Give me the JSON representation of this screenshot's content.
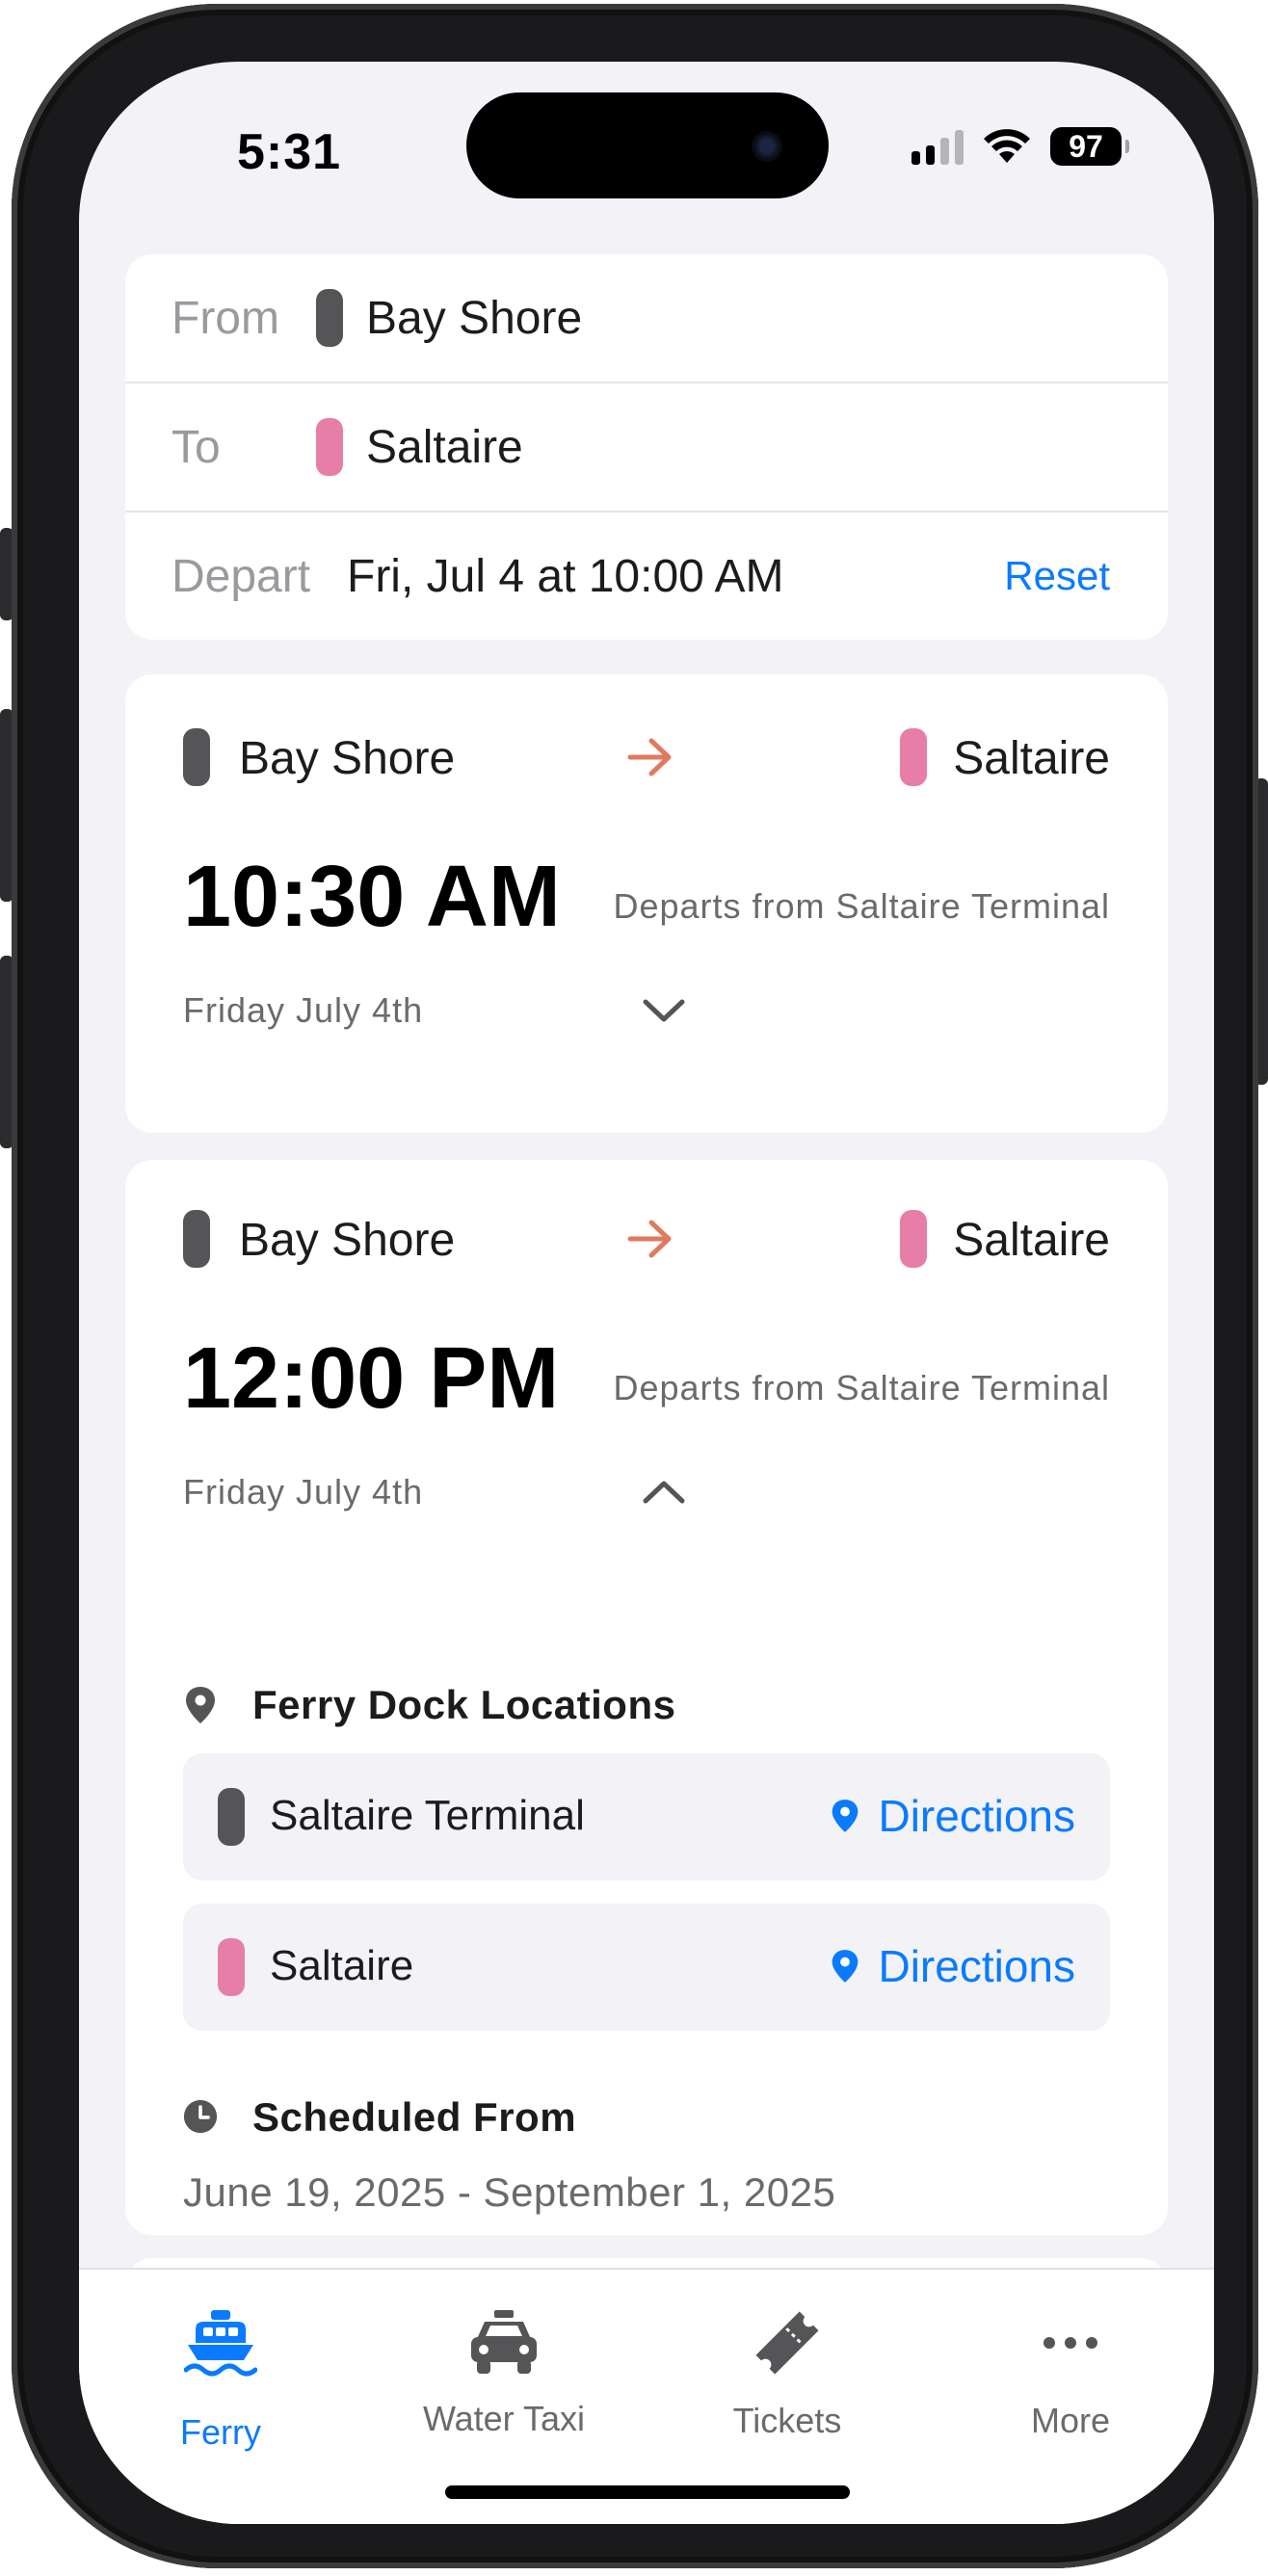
{
  "status_bar": {
    "time": "5:31",
    "battery": "97"
  },
  "trip_form": {
    "from_label": "From",
    "from_value": "Bay Shore",
    "to_label": "To",
    "to_value": "Saltaire",
    "depart_label": "Depart",
    "depart_value": "Fri, Jul 4 at 10:00 AM",
    "reset_label": "Reset"
  },
  "ferries": [
    {
      "origin": "Bay Shore",
      "destination": "Saltaire",
      "time": "10:30 AM",
      "departs_from": "Departs from Saltaire Terminal",
      "date": "Friday July 4th",
      "expanded": false
    },
    {
      "origin": "Bay Shore",
      "destination": "Saltaire",
      "time": "12:00 PM",
      "departs_from": "Departs from Saltaire Terminal",
      "date": "Friday July 4th",
      "expanded": true,
      "dock_section_title": "Ferry Dock Locations",
      "docks": [
        {
          "name": "Saltaire Terminal",
          "directions_label": "Directions"
        },
        {
          "name": "Saltaire",
          "directions_label": "Directions"
        }
      ],
      "schedule_title": "Scheduled From",
      "schedule_range": "June 19, 2025 - September 1, 2025"
    }
  ],
  "tab_bar": {
    "tabs": [
      {
        "label": "Ferry",
        "icon": "ferry-icon",
        "active": true
      },
      {
        "label": "Water Taxi",
        "icon": "taxi-icon",
        "active": false
      },
      {
        "label": "Tickets",
        "icon": "ticket-icon",
        "active": false
      },
      {
        "label": "More",
        "icon": "more-icon",
        "active": false
      }
    ]
  },
  "colors": {
    "accent": "#0a7aff",
    "origin_pill": "#555557",
    "destination_pill": "#e77ea8",
    "route_arrow": "#e07a5f"
  }
}
